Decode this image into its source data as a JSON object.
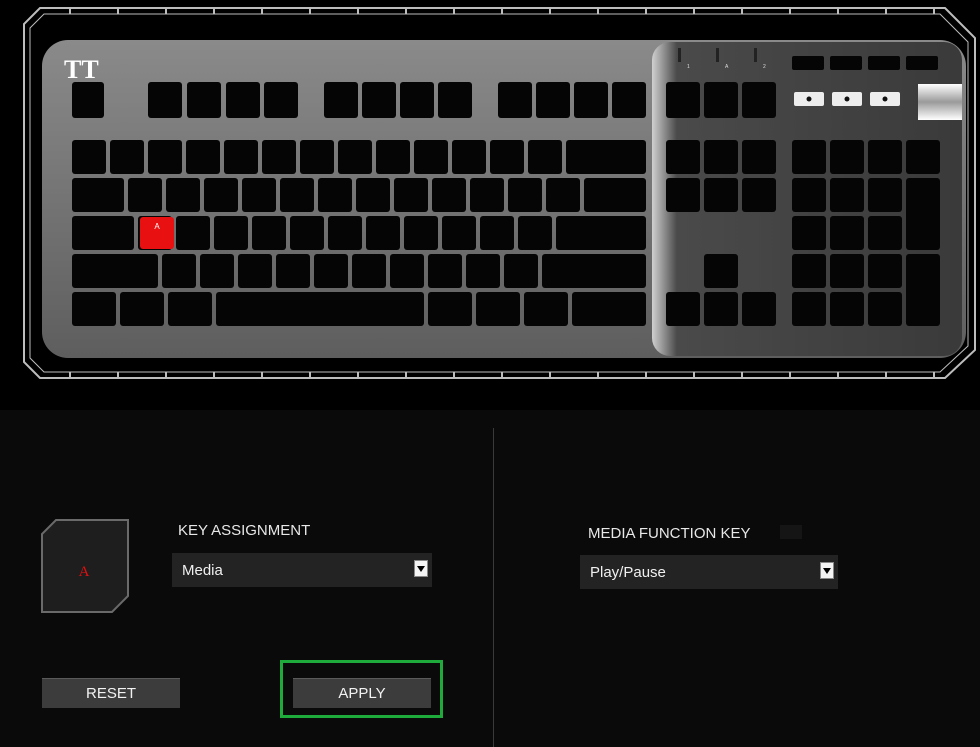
{
  "keyboard": {
    "brand_logo": "TT",
    "highlighted_key_label": "A",
    "led_labels": [
      "1",
      "A",
      "2"
    ],
    "media_icons": [
      "mouse-icon",
      "light-bulb-icon",
      "record-icon"
    ],
    "colors": {
      "body": "#6e6e6e",
      "keycap": "#050505",
      "highlight": "#e81010",
      "frame": "#bdbdbd"
    }
  },
  "preview": {
    "key_label": "A"
  },
  "key_assignment": {
    "label": "KEY ASSIGNMENT",
    "value": "Media"
  },
  "media_function": {
    "label": "MEDIA FUNCTION KEY",
    "value": "Play/Pause"
  },
  "buttons": {
    "reset": "RESET",
    "apply": "APPLY"
  },
  "colors": {
    "accent_green": "#1faa3c",
    "panel_bg": "#0a0a0a"
  }
}
